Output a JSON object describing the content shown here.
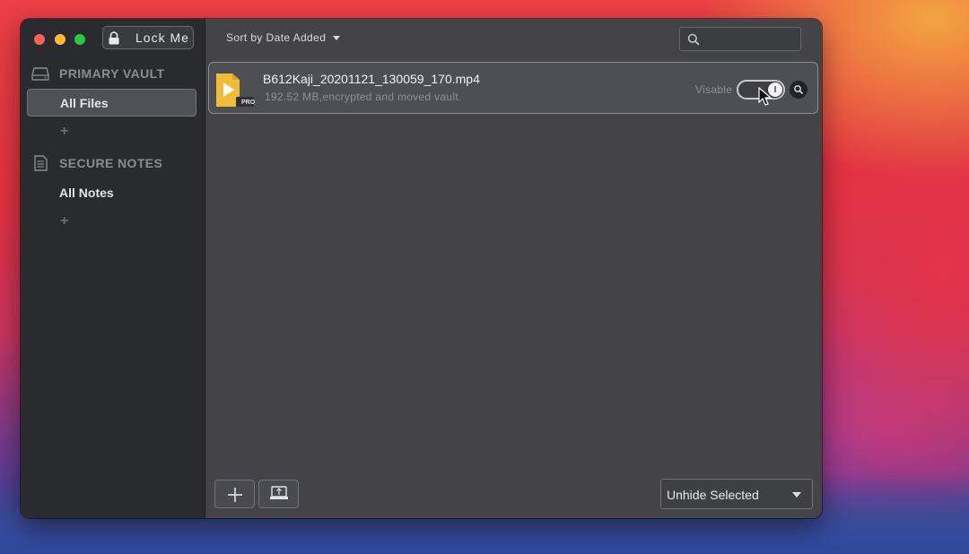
{
  "window": {
    "lock_button_label": "Lock Me"
  },
  "sidebar": {
    "sections": [
      {
        "title": "PRIMARY VAULT",
        "icon": "drive-icon",
        "items": [
          {
            "label": "All Files",
            "selected": true
          }
        ]
      },
      {
        "title": "SECURE NOTES",
        "icon": "note-icon",
        "items": [
          {
            "label": "All Notes",
            "selected": false
          }
        ]
      }
    ],
    "add_glyph": "+"
  },
  "toolbar": {
    "sort_label": "Sort by Date Added",
    "search_placeholder": ""
  },
  "files": [
    {
      "name": "B612Kaji_20201121_130059_170.mp4",
      "meta": "192.52 MB,encrypted and moved vault.",
      "badge": "PRO",
      "visibility_label": "Visable",
      "visible": true
    }
  ],
  "footer": {
    "unhide_label": "Unhide Selected"
  },
  "colors": {
    "file_icon": "#f2bd35",
    "sidebar_bg": "#2a2b2e",
    "content_bg": "#444448"
  }
}
